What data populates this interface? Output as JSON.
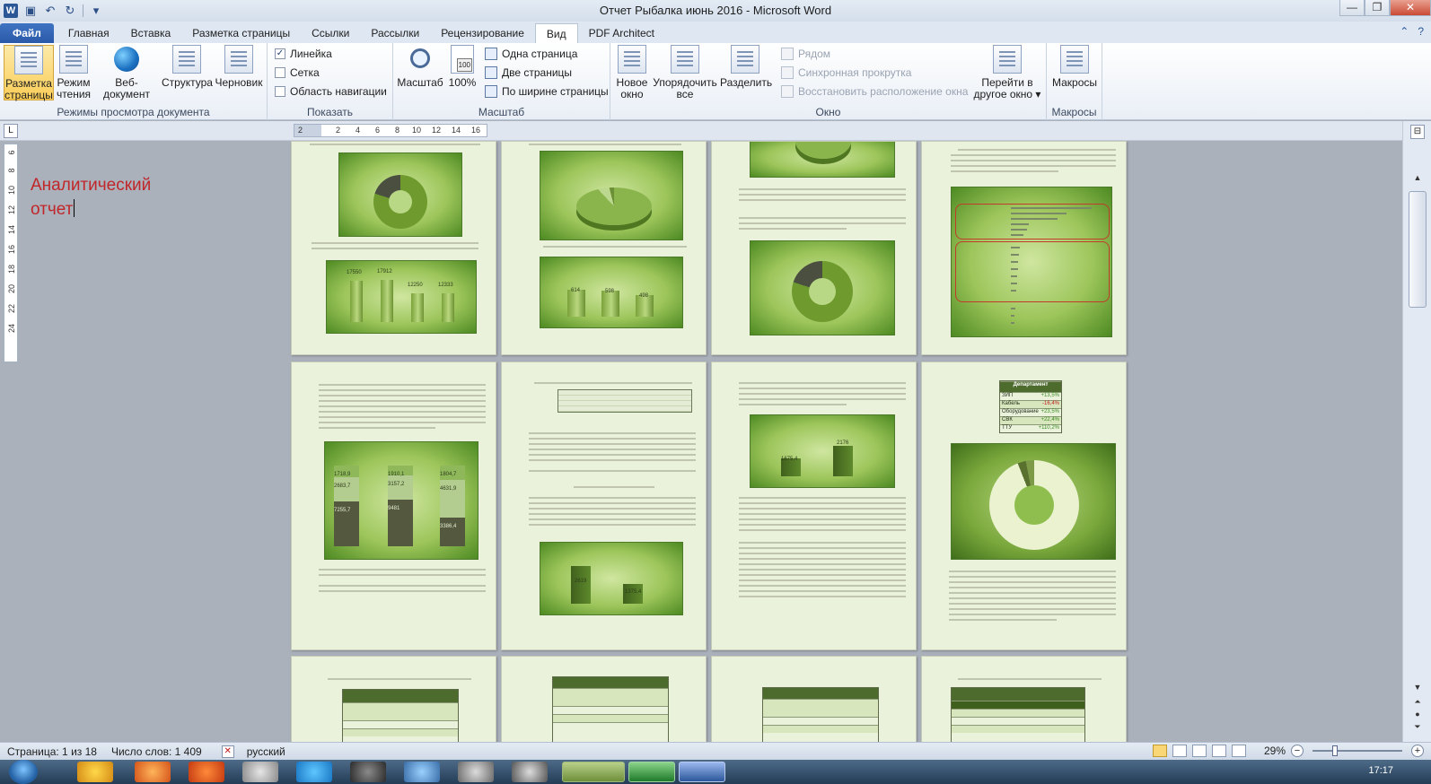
{
  "window": {
    "title": "Отчет Рыбалка июнь 2016  -  Microsoft Word",
    "qat_logo": "W",
    "controls": {
      "minimize": "—",
      "restore": "❐",
      "close": "✕"
    }
  },
  "tabs": [
    "Главная",
    "Вставка",
    "Разметка страницы",
    "Ссылки",
    "Рассылки",
    "Рецензирование",
    "Вид",
    "PDF Architect"
  ],
  "file_tab": "Файл",
  "active_tab": "Вид",
  "ribbon": {
    "views_group": {
      "label": "Режимы просмотра документа",
      "buttons": [
        {
          "line1": "Разметка",
          "line2": "страницы"
        },
        {
          "line1": "Режим",
          "line2": "чтения"
        },
        {
          "line1": "Веб-документ",
          "line2": ""
        },
        {
          "line1": "Структура",
          "line2": ""
        },
        {
          "line1": "Черновик",
          "line2": ""
        }
      ]
    },
    "show_group": {
      "label": "Показать",
      "items": [
        {
          "label": "Линейка",
          "checked": true,
          "mark": "✓"
        },
        {
          "label": "Сетка",
          "checked": false,
          "mark": ""
        },
        {
          "label": "Область навигации",
          "checked": false,
          "mark": ""
        }
      ]
    },
    "zoom_group": {
      "label": "Масштаб",
      "zoom_button": "Масштаб",
      "hundred_button": "100%",
      "hundred_icon_text": "100",
      "one_page": "Одна страница",
      "two_pages": "Две страницы",
      "page_width": "По ширине страницы"
    },
    "window_group": {
      "label": "Окно",
      "new_window": {
        "line1": "Новое",
        "line2": "окно"
      },
      "arrange_all": {
        "line1": "Упорядочить",
        "line2": "все"
      },
      "split": "Разделить",
      "side_by_side": "Рядом",
      "sync_scroll": "Синхронная прокрутка",
      "reset_position": "Восстановить расположение окна",
      "switch_windows": {
        "line1": "Перейти в",
        "line2": "другое окно ▾"
      }
    },
    "macros_group": {
      "label": "Макросы",
      "macros_button": "Макросы"
    }
  },
  "ruler": {
    "h_ticks": [
      "2",
      "2",
      "4",
      "6",
      "8",
      "10",
      "12",
      "14",
      "16"
    ],
    "v_ticks": [
      "6",
      "8",
      "10",
      "12",
      "14",
      "16",
      "18",
      "20",
      "22",
      "24"
    ],
    "tab_selector": "L"
  },
  "document": {
    "heading_line1": "Аналитический",
    "heading_line2": "отчет",
    "page_charts": {
      "p1_bars": [
        "17550",
        "17912",
        "12250",
        "12333"
      ],
      "p2_bars": [
        "614",
        "598",
        "498"
      ],
      "p5_stack_top": [
        "1718,9",
        "1910,1",
        "1804,7"
      ],
      "p5_stack_mid": [
        "2683,7",
        "3157,2",
        "4631,9"
      ],
      "p5_stack_bot": [
        "7255,7",
        "9481",
        "3386,4"
      ],
      "p6_bars": [
        "2619",
        "1375,4"
      ],
      "p7_bars": [
        "1675,4",
        "2176"
      ],
      "p8_table": [
        {
          "name": "ЗИП",
          "value": "+13,5%",
          "color": "#3a8a1f"
        },
        {
          "name": "Кабель",
          "value": "-16,4%",
          "color": "#c2201d"
        },
        {
          "name": "Оборудование",
          "value": "+23,5%",
          "color": "#3a8a1f"
        },
        {
          "name": "СВК",
          "value": "+22,4%",
          "color": "#3a8a1f"
        },
        {
          "name": "ТТУ",
          "value": "+110,2%",
          "color": "#3a8a1f"
        }
      ]
    }
  },
  "status": {
    "page": "Страница: 1 из 18",
    "words": "Число слов: 1 409",
    "language": "русский",
    "spell_icon": "✕",
    "zoom": "29%",
    "zoom_out": "−",
    "zoom_in": "+"
  },
  "taskbar": {
    "time": "17:17"
  },
  "colors": {
    "heading": "#c0262a",
    "file_tab": "#2a59a8",
    "page_bg": "#eaf2dc"
  }
}
